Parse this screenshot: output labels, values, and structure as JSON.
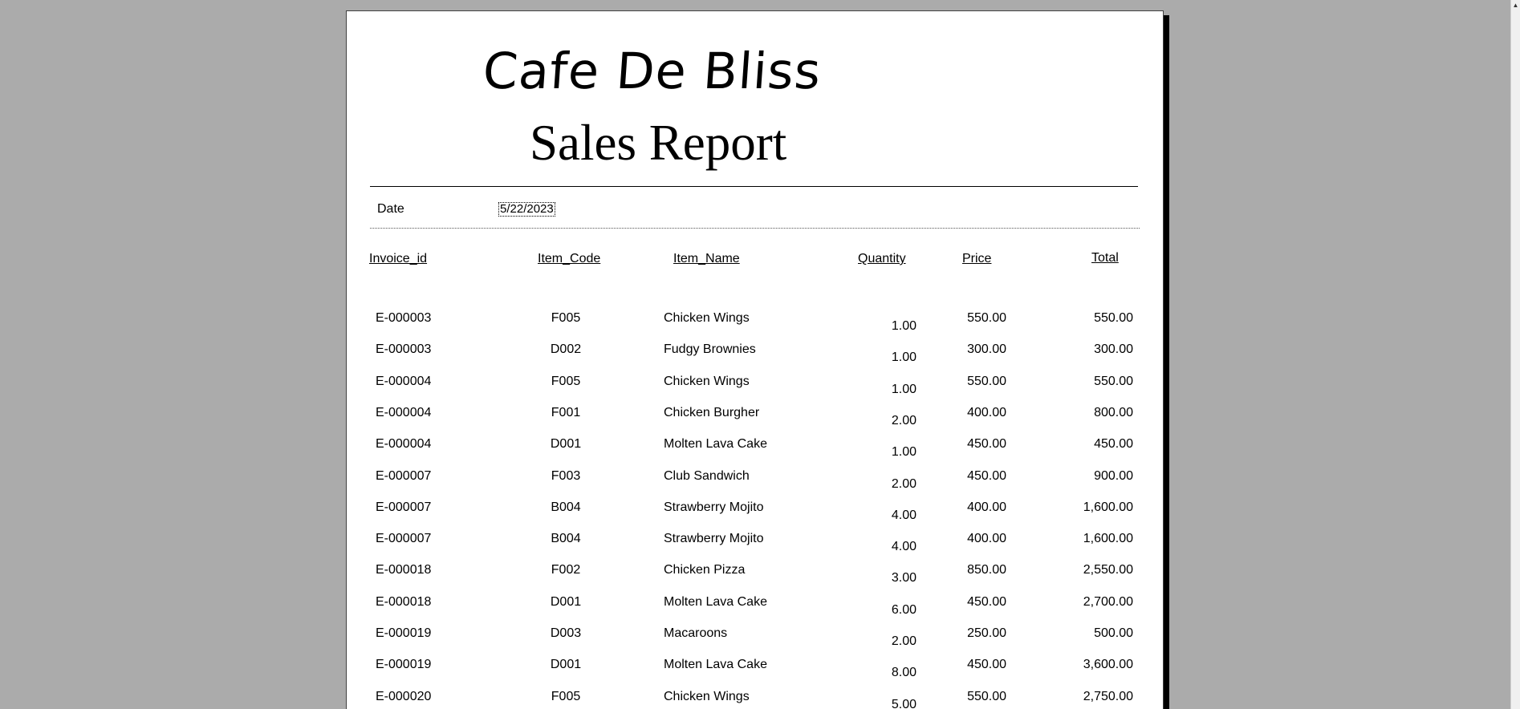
{
  "report": {
    "cafe_name": "Cafe De Bliss",
    "title": "Sales Report",
    "date_label": "Date",
    "date_value": "5/22/2023"
  },
  "columns": {
    "invoice_id": "Invoice_id",
    "item_code": "Item_Code",
    "item_name": "Item_Name",
    "quantity": "Quantity",
    "price": "Price",
    "total": "Total"
  },
  "rows": [
    {
      "invoice_id": "E-000003",
      "item_code": "F005",
      "item_name": "Chicken Wings",
      "quantity": "1.00",
      "price": "550.00",
      "total": "550.00"
    },
    {
      "invoice_id": "E-000003",
      "item_code": "D002",
      "item_name": "Fudgy Brownies",
      "quantity": "1.00",
      "price": "300.00",
      "total": "300.00"
    },
    {
      "invoice_id": "E-000004",
      "item_code": "F005",
      "item_name": "Chicken Wings",
      "quantity": "1.00",
      "price": "550.00",
      "total": "550.00"
    },
    {
      "invoice_id": "E-000004",
      "item_code": "F001",
      "item_name": "Chicken Burgher",
      "quantity": "2.00",
      "price": "400.00",
      "total": "800.00"
    },
    {
      "invoice_id": "E-000004",
      "item_code": "D001",
      "item_name": "Molten Lava Cake",
      "quantity": "1.00",
      "price": "450.00",
      "total": "450.00"
    },
    {
      "invoice_id": "E-000007",
      "item_code": "F003",
      "item_name": "Club Sandwich",
      "quantity": "2.00",
      "price": "450.00",
      "total": "900.00"
    },
    {
      "invoice_id": "E-000007",
      "item_code": "B004",
      "item_name": "Strawberry Mojito",
      "quantity": "4.00",
      "price": "400.00",
      "total": "1,600.00"
    },
    {
      "invoice_id": "E-000007",
      "item_code": "B004",
      "item_name": "Strawberry Mojito",
      "quantity": "4.00",
      "price": "400.00",
      "total": "1,600.00"
    },
    {
      "invoice_id": "E-000018",
      "item_code": "F002",
      "item_name": "Chicken Pizza",
      "quantity": "3.00",
      "price": "850.00",
      "total": "2,550.00"
    },
    {
      "invoice_id": "E-000018",
      "item_code": "D001",
      "item_name": "Molten Lava Cake",
      "quantity": "6.00",
      "price": "450.00",
      "total": "2,700.00"
    },
    {
      "invoice_id": "E-000019",
      "item_code": "D003",
      "item_name": "Macaroons",
      "quantity": "2.00",
      "price": "250.00",
      "total": "500.00"
    },
    {
      "invoice_id": "E-000019",
      "item_code": "D001",
      "item_name": "Molten Lava Cake",
      "quantity": "8.00",
      "price": "450.00",
      "total": "3,600.00"
    },
    {
      "invoice_id": "E-000020",
      "item_code": "F005",
      "item_name": "Chicken Wings",
      "quantity": "5.00",
      "price": "550.00",
      "total": "2,750.00"
    }
  ]
}
